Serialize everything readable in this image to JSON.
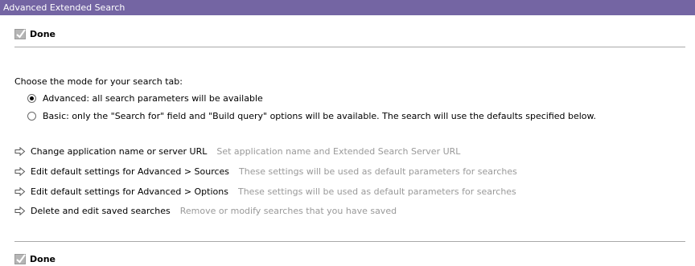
{
  "window": {
    "title": "Advanced Extended Search"
  },
  "done": {
    "label": "Done"
  },
  "mode": {
    "prompt": "Choose the mode for your search tab:",
    "options": [
      {
        "label": "Advanced: all search parameters will be available",
        "selected": true
      },
      {
        "label": "Basic: only the \"Search for\" field and \"Build query\" options will be available. The search will use the defaults specified below.",
        "selected": false
      }
    ]
  },
  "links": [
    {
      "label": "Change application name or server URL",
      "description": "Set application name and Extended Search Server URL",
      "icon": "arrow-right-icon"
    },
    {
      "label": "Edit default settings for Advanced > Sources",
      "description": "These settings will be used as default parameters for searches",
      "icon": "arrow-right-icon"
    },
    {
      "label": "Edit default settings for Advanced > Options",
      "description": "These settings will be used as default parameters for searches",
      "icon": "arrow-right-icon"
    },
    {
      "label": "Delete and edit saved searches",
      "description": "Remove or modify searches that you have saved",
      "icon": "arrow-right-icon"
    }
  ],
  "colors": {
    "titlebar": "#7465a3",
    "description": "#999999"
  }
}
